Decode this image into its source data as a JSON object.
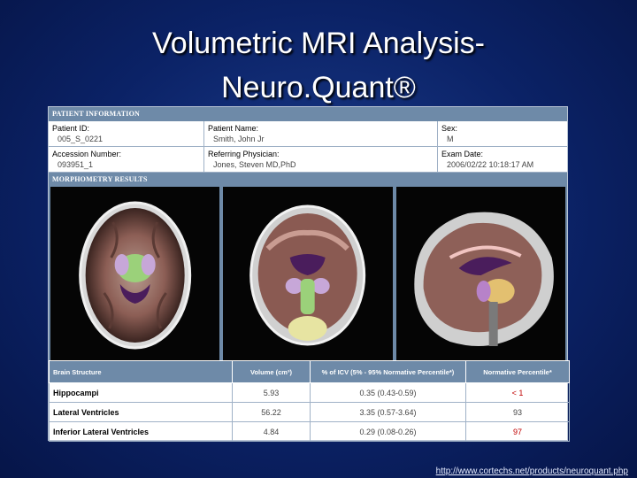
{
  "title": {
    "line1": "Volumetric MRI Analysis-",
    "line2": "Neuro.Quant®"
  },
  "patient_info": {
    "section_label": "PATIENT INFORMATION",
    "patient_id_label": "Patient ID:",
    "patient_id": "005_S_0221",
    "patient_name_label": "Patient Name:",
    "patient_name": "Smith, John Jr",
    "sex_label": "Sex:",
    "sex": "M",
    "accession_label": "Accession Number:",
    "accession": "093951_1",
    "physician_label": "Referring Physician:",
    "physician": "Jones, Steven MD,PhD",
    "exam_date_label": "Exam Date:",
    "exam_date": "2006/02/22 10:18:17 AM"
  },
  "morphometry": {
    "section_label": "MORPHOMETRY RESULTS",
    "images": [
      "axial-mri-image",
      "coronal-mri-image",
      "sagittal-mri-image"
    ]
  },
  "results": {
    "headers": [
      "Brain Structure",
      "Volume (cm³)",
      "% of ICV (5% - 95% Normative Percentile*)",
      "Normative Percentile*"
    ],
    "rows": [
      {
        "structure": "Hippocampi",
        "volume": "5.93",
        "icv": "0.35 (0.43-0.59)",
        "percentile": "< 1",
        "percentile_color": "#c00000"
      },
      {
        "structure": "Lateral Ventricles",
        "volume": "56.22",
        "icv": "3.35 (0.57-3.64)",
        "percentile": "93",
        "percentile_color": "#444444"
      },
      {
        "structure": "Inferior Lateral Ventricles",
        "volume": "4.84",
        "icv": "0.29 (0.08-0.26)",
        "percentile": "97",
        "percentile_color": "#c00000"
      }
    ]
  },
  "footer_link": "http://www.cortechs.net/products/neuroquant.php"
}
